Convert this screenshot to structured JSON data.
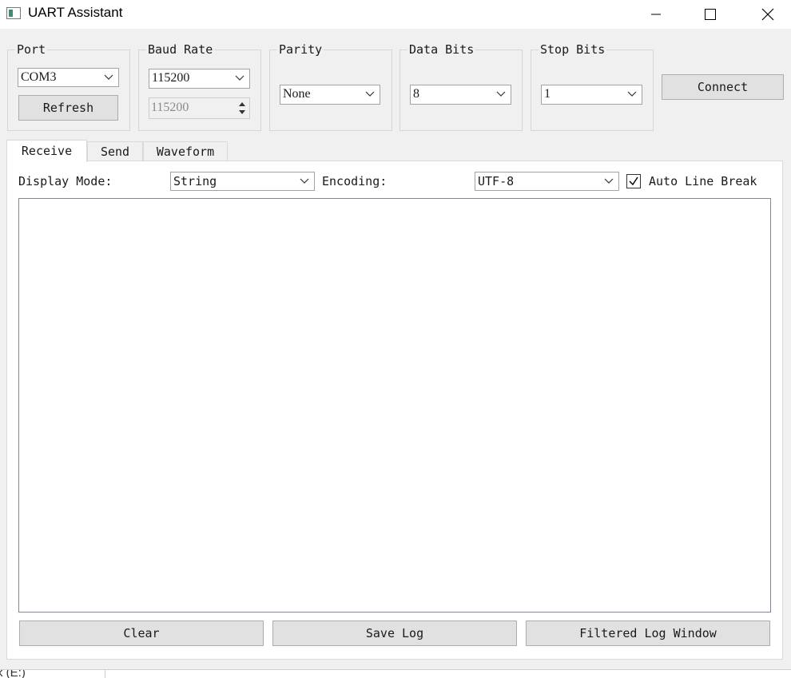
{
  "window": {
    "title": "UART Assistant"
  },
  "port": {
    "group_title": "Port",
    "selected": "COM3",
    "refresh_label": "Refresh"
  },
  "baud": {
    "group_title": "Baud Rate",
    "selected": "115200",
    "custom_value": "115200"
  },
  "parity": {
    "group_title": "Parity",
    "selected": "None"
  },
  "data_bits": {
    "group_title": "Data Bits",
    "selected": "8"
  },
  "stop_bits": {
    "group_title": "Stop Bits",
    "selected": "1"
  },
  "connect_label": "Connect",
  "tabs": [
    {
      "label": "Receive",
      "active": true
    },
    {
      "label": "Send",
      "active": false
    },
    {
      "label": "Waveform",
      "active": false
    }
  ],
  "receive": {
    "display_mode_label": "Display Mode:",
    "display_mode_value": "String",
    "encoding_label": "Encoding:",
    "encoding_value": "UTF-8",
    "auto_line_break_label": "Auto Line Break",
    "auto_line_break_checked": true,
    "output_text": "",
    "clear_label": "Clear",
    "save_log_label": "Save Log",
    "filtered_log_label": "Filtered Log Window"
  },
  "taskbar_fragment": "k (E:)",
  "colors": {
    "window_bg": "#f0f0f0",
    "button_bg": "#e1e1e1",
    "panel_bg": "#ffffff",
    "app_icon_accent": "#3d8c7a"
  },
  "icons": {
    "app": "app-window-icon",
    "minimize": "minimize-icon",
    "maximize": "maximize-icon",
    "close": "close-icon",
    "dropdown": "chevron-down-icon",
    "spin_up": "arrow-up-icon",
    "spin_down": "arrow-down-icon",
    "check": "checkmark-icon"
  }
}
